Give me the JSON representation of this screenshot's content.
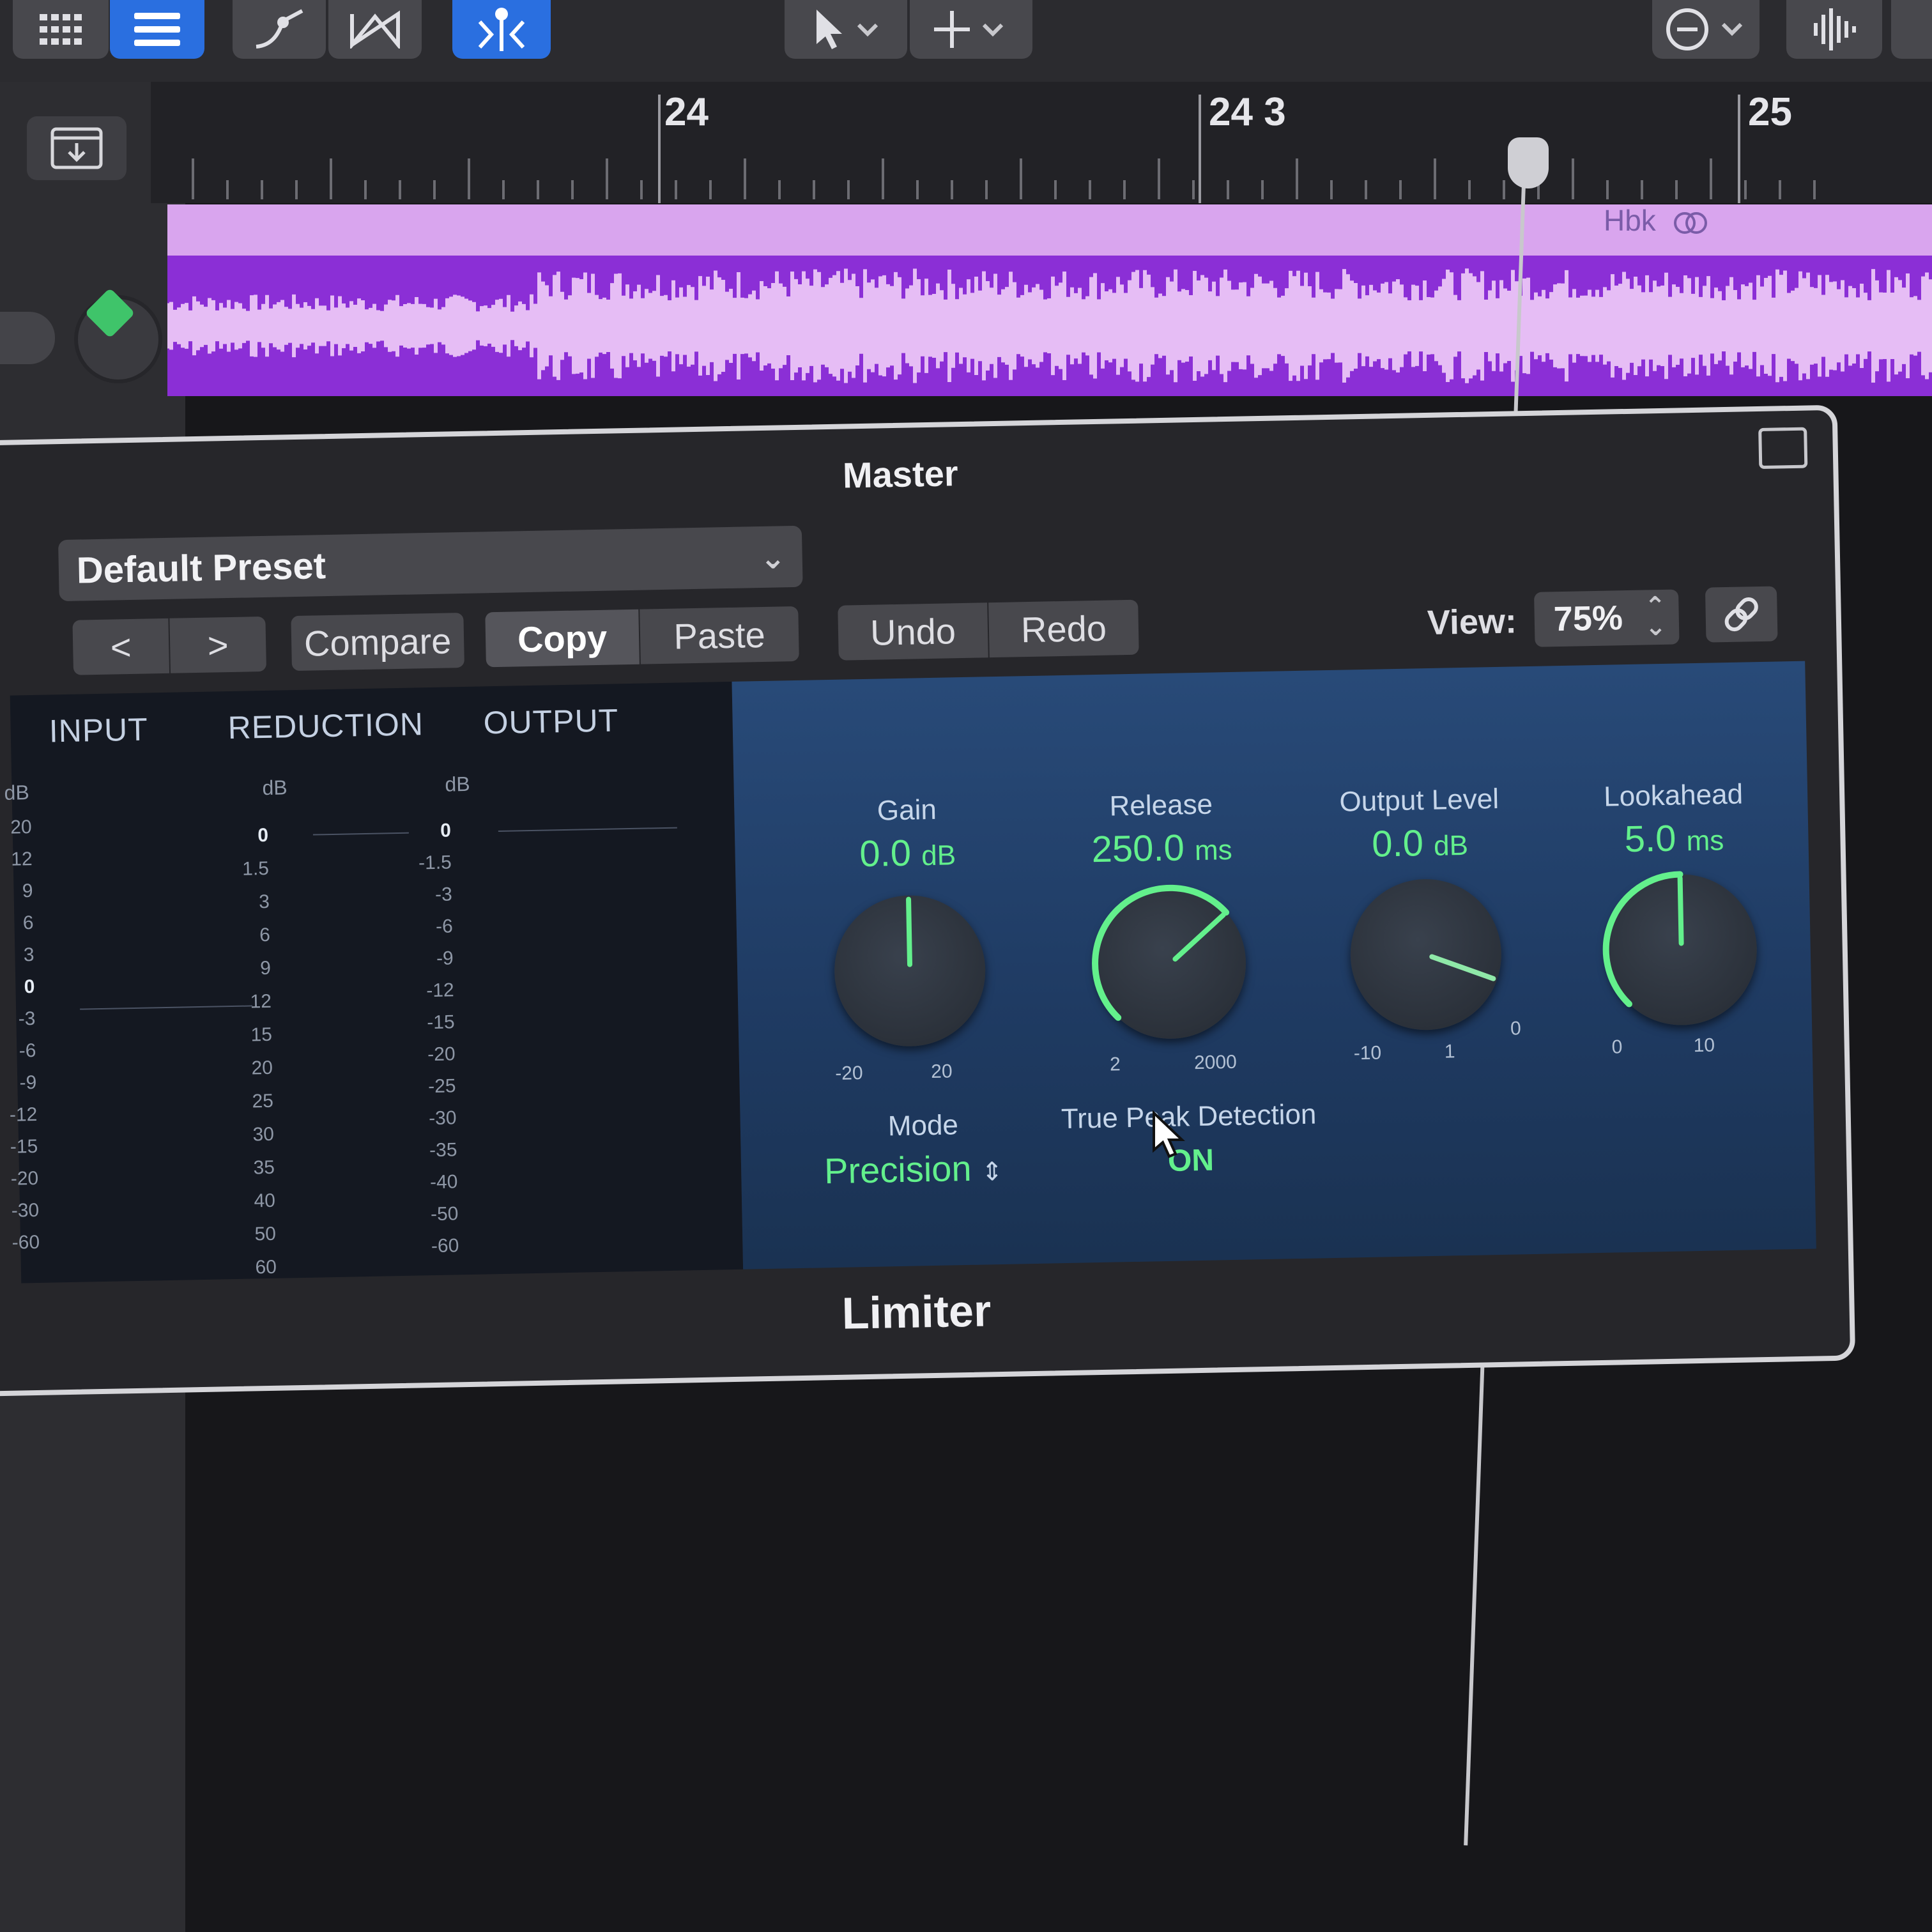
{
  "toolbar": {
    "buttons": [
      {
        "name": "grid-view",
        "icon": "grid-icon",
        "active": false
      },
      {
        "name": "list-editors",
        "icon": "list-icon",
        "active": true
      },
      {
        "name": "automation",
        "icon": "automation-curve-icon",
        "active": false
      },
      {
        "name": "flex",
        "icon": "flex-icon",
        "active": false
      },
      {
        "name": "snap",
        "icon": "catch-icon",
        "active": true
      },
      {
        "name": "pointer-tool",
        "icon": "pointer-icon",
        "active": false
      },
      {
        "name": "pencil-tool",
        "icon": "crosshair-icon",
        "active": false
      },
      {
        "name": "view-menu",
        "icon": "ellipsis-circle-icon",
        "active": false
      },
      {
        "name": "waveform",
        "icon": "waveform-icon",
        "active": false
      }
    ]
  },
  "timeline": {
    "bars": [
      "24",
      "24 3",
      "25"
    ],
    "region_name": "Hbk",
    "region_color": "#d9a5ee",
    "wave_color": "#8b2fd6"
  },
  "plugin": {
    "window_title": "Master",
    "preset": "Default Preset",
    "buttons": {
      "prev": "<",
      "next": ">",
      "compare": "Compare",
      "copy": "Copy",
      "paste": "Paste",
      "undo": "Undo",
      "redo": "Redo"
    },
    "view": {
      "label": "View:",
      "value": "75%"
    },
    "meters": {
      "input": {
        "title": "INPUT",
        "unit": "dB",
        "scale": [
          "20",
          "12",
          "9",
          "6",
          "3",
          "0",
          "-3",
          "-6",
          "-9",
          "-12",
          "-15",
          "-20",
          "-30",
          "-60"
        ]
      },
      "reduction": {
        "title": "REDUCTION",
        "unit": "dB",
        "scale": [
          "0",
          "1.5",
          "3",
          "6",
          "9",
          "12",
          "15",
          "20",
          "25",
          "30",
          "35",
          "40",
          "50",
          "60"
        ]
      },
      "output": {
        "title": "OUTPUT",
        "unit": "dB",
        "scale": [
          "0",
          "-1.5",
          "-3",
          "-6",
          "-9",
          "-12",
          "-15",
          "-20",
          "-25",
          "-30",
          "-35",
          "-40",
          "-50",
          "-60"
        ]
      }
    },
    "controls": {
      "gain": {
        "label": "Gain",
        "value": "0.0",
        "unit": "dB",
        "min": "-20",
        "max": "20",
        "fraction": 0.5,
        "ring": false
      },
      "release": {
        "label": "Release",
        "value": "250.0",
        "unit": "ms",
        "min": "2",
        "max": "2000",
        "fraction": 0.68,
        "ring": true
      },
      "output_level": {
        "label": "Output Level",
        "value": "0.0",
        "unit": "dB",
        "min": "-10",
        "max": "1",
        "extra": "0",
        "fraction": 0.91,
        "ring": false
      },
      "lookahead": {
        "label": "Lookahead",
        "value": "5.0",
        "unit": "ms",
        "min": "0",
        "max": "10",
        "fraction": 0.5,
        "ring": true
      }
    },
    "mode": {
      "label": "Mode",
      "value": "Precision"
    },
    "true_peak": {
      "label": "True Peak Detection",
      "value": "ON"
    },
    "plugin_name": "Limiter",
    "accent": "#63f08c",
    "panel_color": "#284a78"
  }
}
